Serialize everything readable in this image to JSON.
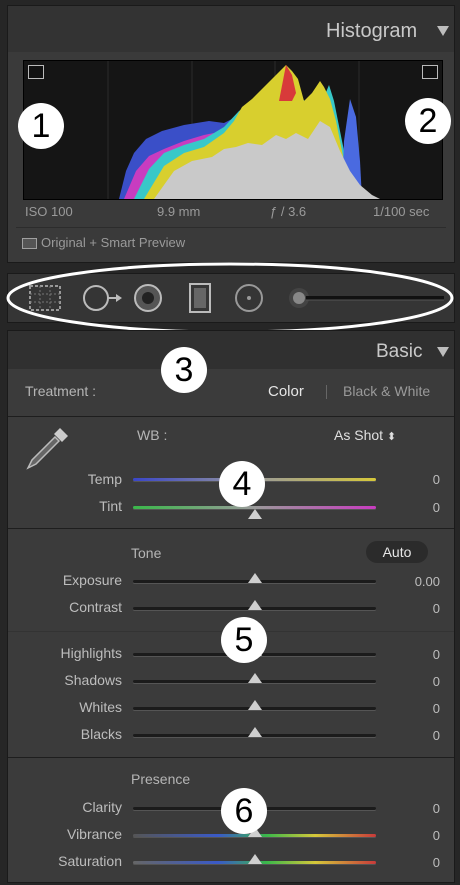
{
  "histogram": {
    "title": "Histogram",
    "iso": "ISO 100",
    "focal": "9.9 mm",
    "aperture": "ƒ / 3.6",
    "shutter": "1/100 sec",
    "preview_label": "Original + Smart Preview"
  },
  "tools": [
    "crop-overlay",
    "spot-removal",
    "red-eye",
    "graduated-filter",
    "radial-filter",
    "adjustment-brush"
  ],
  "basic": {
    "title": "Basic",
    "treatment_label": "Treatment :",
    "treatment_color": "Color",
    "treatment_bw": "Black & White",
    "wb_label": "WB :",
    "wb_value": "As Shot",
    "wb_arrows": "⬍",
    "temp_label": "Temp",
    "temp_value": "0",
    "tint_label": "Tint",
    "tint_value": "0",
    "tone_label": "Tone",
    "auto_label": "Auto",
    "exposure_label": "Exposure",
    "exposure_value": "0.00",
    "contrast_label": "Contrast",
    "contrast_value": "0",
    "highlights_label": "Highlights",
    "highlights_value": "0",
    "shadows_label": "Shadows",
    "shadows_value": "0",
    "whites_label": "Whites",
    "whites_value": "0",
    "blacks_label": "Blacks",
    "blacks_value": "0",
    "presence_label": "Presence",
    "clarity_label": "Clarity",
    "clarity_value": "0",
    "vibrance_label": "Vibrance",
    "vibrance_value": "0",
    "saturation_label": "Saturation",
    "saturation_value": "0"
  },
  "annotations": [
    "1",
    "2",
    "3",
    "4",
    "5",
    "6"
  ],
  "colors": {
    "panel_bg": "#3b3b3b",
    "header_bg": "#2c2c2c",
    "text": "#bdbdbd"
  }
}
